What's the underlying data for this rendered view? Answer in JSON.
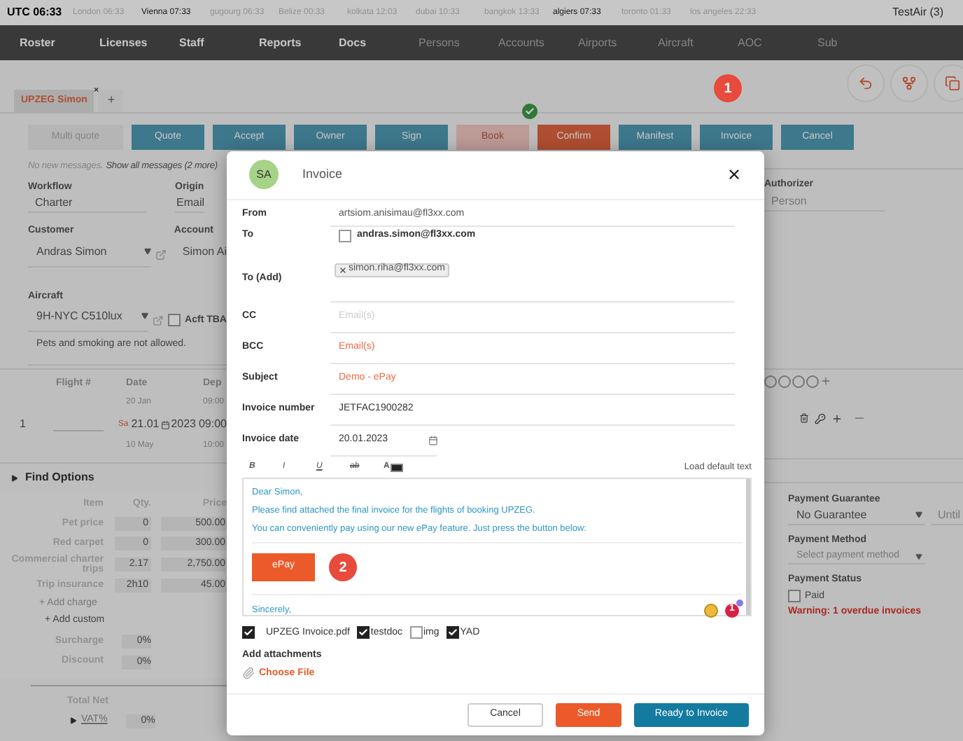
{
  "clock_bar": {
    "utc": "UTC 06:33",
    "clocks": [
      {
        "label": "London 06:33",
        "highlighted": false
      },
      {
        "label": "Vienna 07:33",
        "highlighted": true
      },
      {
        "label": "gugourg 06:33",
        "highlighted": false
      },
      {
        "label": "Belize 00:33",
        "highlighted": false
      },
      {
        "label": "kolkata 12:03",
        "highlighted": false
      },
      {
        "label": "dubai 10:33",
        "highlighted": false
      },
      {
        "label": "bangkok 13:33",
        "highlighted": false
      },
      {
        "label": "algiers 07:33",
        "highlighted": true
      },
      {
        "label": "toronto 01:33",
        "highlighted": false
      },
      {
        "label": "los angeles 22:33",
        "highlighted": false
      }
    ],
    "account": "TestAir (3)"
  },
  "nav": [
    {
      "label": "Roster",
      "enabled": true
    },
    {
      "label": "Licenses",
      "enabled": true
    },
    {
      "label": "Staff",
      "enabled": true
    },
    {
      "label": "Reports",
      "enabled": true
    },
    {
      "label": "Docs",
      "enabled": true
    },
    {
      "label": "Persons",
      "enabled": false
    },
    {
      "label": "Accounts",
      "enabled": false
    },
    {
      "label": "Airports",
      "enabled": false
    },
    {
      "label": "Aircraft",
      "enabled": false
    },
    {
      "label": "AOC",
      "enabled": false
    },
    {
      "label": "Sub",
      "enabled": false
    }
  ],
  "tabs": [
    {
      "label": "UPZEG Simon",
      "selected": true,
      "close": "×"
    }
  ],
  "add_tab": "+",
  "actions": [
    {
      "label": "Multi quote",
      "kind": "disabled"
    },
    {
      "label": "Quote",
      "kind": "primary"
    },
    {
      "label": "Accept",
      "kind": "primary"
    },
    {
      "label": "Owner",
      "kind": "primary"
    },
    {
      "label": "Sign",
      "kind": "primary"
    },
    {
      "label": "Book",
      "kind": "completed"
    },
    {
      "label": "Confirm",
      "kind": "warning"
    },
    {
      "label": "Manifest",
      "kind": "primary"
    },
    {
      "label": "Invoice",
      "kind": "primary"
    },
    {
      "label": "Cancel",
      "kind": "primary"
    }
  ],
  "callouts": [
    "1",
    "2"
  ],
  "messages": {
    "status": "No new messages.",
    "link": "Show all messages (2 more)"
  },
  "booking": {
    "workflow_label": "Workflow",
    "workflow": "Charter",
    "origin_label": "Origin",
    "origin": "Email",
    "customer_label": "Customer",
    "customer": "Andras Simon",
    "account_label": "Account",
    "account": "Simon Ai",
    "aircraft_label": "Aircraft",
    "aircraft": "9H-NYC C510lux",
    "acft_tba": {
      "label": "Acft TBA",
      "checked": false
    },
    "note": "Pets and smoking are not allowed.",
    "authorizer_label": "Authorizer",
    "authorizer_placeholder": "Person"
  },
  "flights": {
    "columns": [
      "Flight #",
      "Date",
      "Dep"
    ],
    "row": {
      "index": "1",
      "earliest": "20 Jan",
      "day": "Sa",
      "date": "21.01",
      "year": "2023",
      "time": "09:00",
      "latest": "10 May",
      "time_early": "09:00",
      "time_late": "10:00"
    }
  },
  "find_options": {
    "label": "Find Options",
    "expanded": false
  },
  "pricing": {
    "columns": [
      "Item",
      "Qty.",
      "Price"
    ],
    "rows": [
      {
        "item": "Pet price",
        "qty": "0",
        "price": "500.00"
      },
      {
        "item": "Red carpet",
        "qty": "0",
        "price": "300.00"
      },
      {
        "item": "Commercial charter trips",
        "qty": "2.17",
        "price": "2,750.00"
      },
      {
        "item": "Trip insurance",
        "qty": "2h10",
        "price": "45.00"
      }
    ],
    "add_charge": "+ Add charge",
    "add_custom": "+ Add custom",
    "adjustments": [
      {
        "label": "Surcharge",
        "value": "0%"
      },
      {
        "label": "Discount",
        "value": "0%"
      }
    ],
    "total_net": "Total Net",
    "vat": {
      "label": "VAT%",
      "value": "0%"
    }
  },
  "payment": {
    "guarantee_label": "Payment Guarantee",
    "guarantee": "No Guarantee",
    "until_placeholder": "Until",
    "method_label": "Payment Method",
    "method_placeholder": "Select payment method",
    "status_label": "Payment Status",
    "paid": {
      "label": "Paid",
      "checked": false
    },
    "warning": "Warning: 1 overdue invoices"
  },
  "modal": {
    "avatar": "SA",
    "title": "Invoice",
    "from": {
      "label": "From",
      "value": "artsiom.anisimau@fl3xx.com"
    },
    "to": {
      "label": "To",
      "value": "andras.simon@fl3xx.com",
      "checked": false
    },
    "to_add": {
      "label": "To (Add)",
      "chips": [
        "simon.riha@fl3xx.com"
      ]
    },
    "cc": {
      "label": "CC",
      "placeholder": "Email(s)",
      "required": false
    },
    "bcc": {
      "label": "BCC",
      "placeholder": "Email(s)",
      "required": true
    },
    "subject": {
      "label": "Subject",
      "value": "Demo - ePay"
    },
    "invoice_number": {
      "label": "Invoice number",
      "value": "JETFAC1900282"
    },
    "invoice_date": {
      "label": "Invoice date",
      "value": "20.01.2023"
    },
    "format_buttons": [
      {
        "label": "B",
        "kind": "bold"
      },
      {
        "label": "I",
        "kind": "italic"
      },
      {
        "label": "U",
        "kind": "underline"
      },
      {
        "label": "ab",
        "kind": "strike"
      },
      {
        "label": "A",
        "kind": "color"
      }
    ],
    "load_default": "Load default text",
    "body": {
      "lines": [
        "Dear Simon,",
        "Please find attached the final invoice for the flights of booking UPZEG.",
        "You can conveniently pay using our new ePay feature. Just press the button below:"
      ],
      "pay_button": "ePay",
      "closing": "Sincerely,",
      "notification_count": "1"
    },
    "attachments": [
      {
        "label": "UPZEG Invoice.pdf",
        "checked": true
      },
      {
        "label": "testdoc",
        "checked": true
      },
      {
        "label": "img",
        "checked": false
      },
      {
        "label": "YAD",
        "checked": true
      }
    ],
    "add_attachments": "Add attachments",
    "choose_file": "Choose File",
    "buttons": [
      {
        "label": "Cancel",
        "kind": "secondary"
      },
      {
        "label": "Send",
        "kind": "warning"
      },
      {
        "label": "Ready to Invoice",
        "kind": "primary"
      }
    ]
  }
}
